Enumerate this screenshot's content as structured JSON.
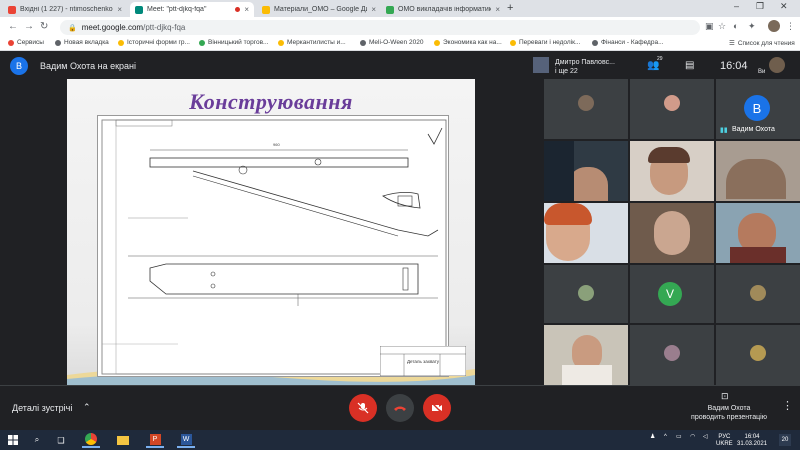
{
  "browser": {
    "tabs": [
      {
        "label": "Вхідні (1 227) - ntimoschenkom...",
        "favicon": "gmail-icon",
        "color": "#ea4335"
      },
      {
        "label": "Meet: \"ptt-djkq-fqa\"",
        "favicon": "meet-icon",
        "color": "#00897b",
        "active": true,
        "recording": true
      },
      {
        "label": "Матеріали_ОМО – Google Диск",
        "favicon": "drive-icon",
        "color": "#fbbc04"
      },
      {
        "label": "ОМО викладачів інформатики",
        "favicon": "sites-icon",
        "color": "#34a853"
      }
    ],
    "newtab_label": "+",
    "url_host": "meet.google.com",
    "url_path": "/ptt-djkq-fqa",
    "bookmarks": [
      {
        "label": "Сервисы",
        "color": "#ea4335"
      },
      {
        "label": "Новая вкладка",
        "color": "#5f6368"
      },
      {
        "label": "Історичні форми гр...",
        "color": "#fbbc04"
      },
      {
        "label": "Вінницький торгов...",
        "color": "#34a853"
      },
      {
        "label": "Меркантилисты и...",
        "color": "#fbbc04"
      },
      {
        "label": "Meli-O-Ween 2020",
        "color": "#5f6368"
      },
      {
        "label": "Экономика как на...",
        "color": "#fbbc04"
      },
      {
        "label": "Переваги і недолік...",
        "color": "#fbbc04"
      },
      {
        "label": "Фінанси - Кафедра...",
        "color": "#5f6368"
      }
    ],
    "reading_list": "Список для чтения"
  },
  "meet": {
    "presenter_initial": "В",
    "presenter_title": "Вадим Охота на екрані",
    "pinned_name_line1": "Дмитро Павловс...",
    "pinned_name_line2": "і ще 22",
    "participants_count": "29",
    "time": "16:04",
    "me_label": "Ви",
    "slide_title": "Конструювання",
    "drawing_dim": "960",
    "stamp_title": "Деталь захвату",
    "participants": [
      {
        "initial": "В",
        "color": "#1a73e8",
        "name": "Вадим Охота"
      },
      {
        "initial": "V",
        "color": "#34a853"
      }
    ],
    "details_label": "Деталі зустрічі",
    "present_label_line1": "Вадим Охота",
    "present_label_line2": "проводить презентацію"
  },
  "taskbar": {
    "lang_line1": "РУС",
    "lang_line2": "UKRE",
    "time": "16:04",
    "date": "31.03.2021",
    "notif_count": "20"
  }
}
